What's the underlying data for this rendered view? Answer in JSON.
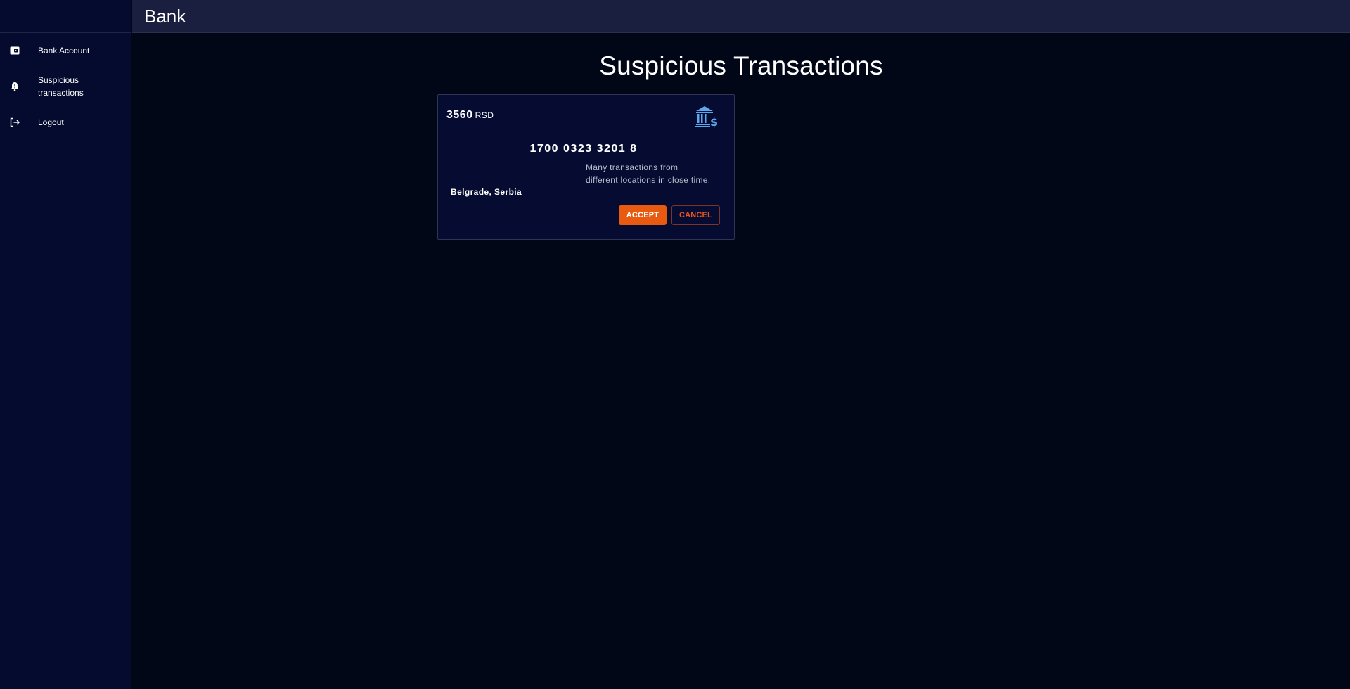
{
  "app": {
    "title": "Bank"
  },
  "sidebar": {
    "items": [
      {
        "label": "Bank Account",
        "icon": "wallet-icon"
      },
      {
        "label": "Suspicious transactions",
        "icon": "bell-alert-icon"
      },
      {
        "label": "Logout",
        "icon": "logout-icon"
      }
    ]
  },
  "main": {
    "title": "Suspicious Transactions",
    "transactions": [
      {
        "amount": "3560",
        "currency": "RSD",
        "account_number": "1700 0323 3201 8",
        "location": "Belgrade, Serbia",
        "reason": "Many transactions from different locations in close time.",
        "accept_label": "ACCEPT",
        "cancel_label": "CANCEL",
        "icon": "bank-dollar-icon"
      }
    ]
  },
  "colors": {
    "background": "#020718",
    "sidebar": "#040b2e",
    "topbar": "#1a1f3f",
    "card": "#050b31",
    "accent": "#e85a0f",
    "icon_blue": "#5aa9f0"
  }
}
